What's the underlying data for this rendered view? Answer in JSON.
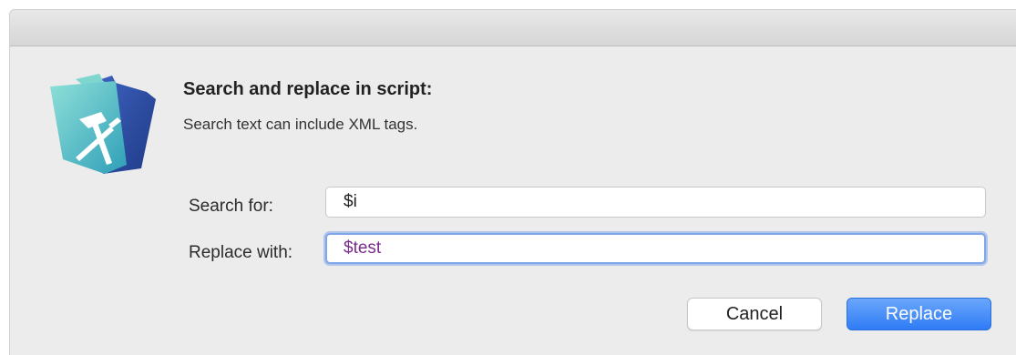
{
  "dialog": {
    "heading": "Search and replace in script:",
    "subtext": "Search text can include XML tags."
  },
  "app_icon": {
    "icon_name": "filemaker-developer-folder-icon",
    "colors": {
      "folder_front": "#55c1c6",
      "folder_back": "#2f4ea3",
      "tool": "#ffffff"
    }
  },
  "form": {
    "search_label": "Search for:",
    "search_value": "$i",
    "replace_label": "Replace with:",
    "replace_value": "$test",
    "replace_text_color": "#7a2d8c",
    "focus_ring_color": "#7fa6e8"
  },
  "buttons": {
    "cancel_label": "Cancel",
    "replace_label": "Replace",
    "primary_color": "#2f7cf6"
  }
}
